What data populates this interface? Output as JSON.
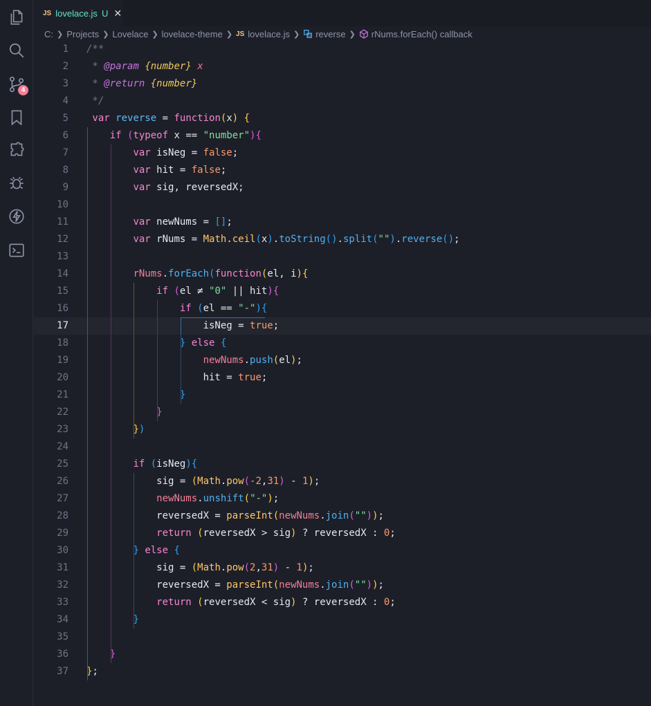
{
  "tab": {
    "js_label": "JS",
    "file_name": "lovelace.js",
    "status": "U",
    "close": "✕"
  },
  "activity_bar": {
    "scm_badge": "4"
  },
  "breadcrumb": {
    "items": [
      "C:",
      "Projects",
      "Lovelace",
      "lovelace-theme"
    ],
    "js_label": "JS",
    "file": "lovelace.js",
    "symbol1": "reverse",
    "symbol2": "rNums.forEach() callback"
  },
  "editor": {
    "current_line": 17,
    "lines": [
      [
        [
          "cm",
          "/**"
        ]
      ],
      [
        [
          "cm",
          " * "
        ],
        [
          "cm-tag",
          "@param"
        ],
        [
          "cm",
          " "
        ],
        [
          "cm-type",
          "{number}"
        ],
        [
          "cm",
          " "
        ],
        [
          "cm-var",
          "x"
        ]
      ],
      [
        [
          "cm",
          " * "
        ],
        [
          "cm-tag",
          "@return"
        ],
        [
          "cm",
          " "
        ],
        [
          "cm-type",
          "{number}"
        ]
      ],
      [
        [
          "cm",
          " */"
        ]
      ],
      [
        [
          "kw",
          " var "
        ],
        [
          "fnname",
          "reverse"
        ],
        [
          "op",
          " = "
        ],
        [
          "kw",
          "function"
        ],
        [
          "p1",
          "("
        ],
        [
          "var",
          "x"
        ],
        [
          "p1",
          ")"
        ],
        [
          "op",
          " "
        ],
        [
          "p1",
          "{"
        ]
      ],
      [
        [
          "op",
          "    "
        ],
        [
          "kw",
          "if"
        ],
        [
          "op",
          " "
        ],
        [
          "p2",
          "("
        ],
        [
          "kw",
          "typeof"
        ],
        [
          "op",
          " x == "
        ],
        [
          "str",
          "\"number\""
        ],
        [
          "p2",
          ")"
        ],
        [
          "p2",
          "{"
        ]
      ],
      [
        [
          "op",
          "        "
        ],
        [
          "kw",
          "var"
        ],
        [
          "op",
          " isNeg = "
        ],
        [
          "bool",
          "false"
        ],
        [
          "op",
          ";"
        ]
      ],
      [
        [
          "op",
          "        "
        ],
        [
          "kw",
          "var"
        ],
        [
          "op",
          " hit = "
        ],
        [
          "bool",
          "false"
        ],
        [
          "op",
          ";"
        ]
      ],
      [
        [
          "op",
          "        "
        ],
        [
          "kw",
          "var"
        ],
        [
          "op",
          " sig, reversedX;"
        ]
      ],
      [],
      [
        [
          "op",
          "        "
        ],
        [
          "kw",
          "var"
        ],
        [
          "op",
          " newNums = "
        ],
        [
          "p3",
          "[]"
        ],
        [
          "op",
          ";"
        ]
      ],
      [
        [
          "op",
          "        "
        ],
        [
          "kw",
          "var"
        ],
        [
          "op",
          " rNums = "
        ],
        [
          "math",
          "Math"
        ],
        [
          "op",
          "."
        ],
        [
          "fn",
          "ceil"
        ],
        [
          "p3",
          "("
        ],
        [
          "var",
          "x"
        ],
        [
          "p3",
          ")"
        ],
        [
          "op",
          "."
        ],
        [
          "meth",
          "toString"
        ],
        [
          "p3",
          "()"
        ],
        [
          "op",
          "."
        ],
        [
          "meth",
          "split"
        ],
        [
          "p3",
          "("
        ],
        [
          "str",
          "\"\""
        ],
        [
          "p3",
          ")"
        ],
        [
          "op",
          "."
        ],
        [
          "meth",
          "reverse"
        ],
        [
          "p3",
          "()"
        ],
        [
          "op",
          ";"
        ]
      ],
      [],
      [
        [
          "op",
          "        "
        ],
        [
          "ident-red",
          "rNums"
        ],
        [
          "op",
          "."
        ],
        [
          "meth",
          "forEach"
        ],
        [
          "p3",
          "("
        ],
        [
          "kw",
          "function"
        ],
        [
          "p1",
          "("
        ],
        [
          "var",
          "el, i"
        ],
        [
          "p1",
          ")"
        ],
        [
          "p1",
          "{"
        ]
      ],
      [
        [
          "op",
          "            "
        ],
        [
          "kw",
          "if"
        ],
        [
          "op",
          " "
        ],
        [
          "p2",
          "("
        ],
        [
          "var",
          "el ≠ "
        ],
        [
          "str",
          "\"0\""
        ],
        [
          "op",
          " || hit"
        ],
        [
          "p2",
          ")"
        ],
        [
          "p2",
          "{"
        ]
      ],
      [
        [
          "op",
          "                "
        ],
        [
          "kw",
          "if"
        ],
        [
          "op",
          " "
        ],
        [
          "p3",
          "("
        ],
        [
          "var",
          "el == "
        ],
        [
          "str",
          "\"-\""
        ],
        [
          "p3",
          ")"
        ],
        [
          "p3",
          "{"
        ]
      ],
      [
        [
          "op",
          "                    isNeg = "
        ],
        [
          "bool",
          "true"
        ],
        [
          "op",
          ";"
        ]
      ],
      [
        [
          "op",
          "                "
        ],
        [
          "p3",
          "}"
        ],
        [
          "op",
          " "
        ],
        [
          "kw",
          "else"
        ],
        [
          "op",
          " "
        ],
        [
          "p3",
          "{"
        ]
      ],
      [
        [
          "op",
          "                    "
        ],
        [
          "ident-red",
          "newNums"
        ],
        [
          "op",
          "."
        ],
        [
          "meth",
          "push"
        ],
        [
          "p1",
          "("
        ],
        [
          "var",
          "el"
        ],
        [
          "p1",
          ")"
        ],
        [
          "op",
          ";"
        ]
      ],
      [
        [
          "op",
          "                    hit = "
        ],
        [
          "bool",
          "true"
        ],
        [
          "op",
          ";"
        ]
      ],
      [
        [
          "op",
          "                "
        ],
        [
          "p3",
          "}"
        ]
      ],
      [
        [
          "op",
          "            "
        ],
        [
          "p2",
          "}"
        ]
      ],
      [
        [
          "op",
          "        "
        ],
        [
          "p1",
          "}"
        ],
        [
          "p3",
          ")"
        ]
      ],
      [],
      [
        [
          "op",
          "        "
        ],
        [
          "kw",
          "if"
        ],
        [
          "op",
          " "
        ],
        [
          "p3",
          "("
        ],
        [
          "var",
          "isNeg"
        ],
        [
          "p3",
          ")"
        ],
        [
          "p3",
          "{"
        ]
      ],
      [
        [
          "op",
          "            sig = "
        ],
        [
          "p1",
          "("
        ],
        [
          "math",
          "Math"
        ],
        [
          "op",
          "."
        ],
        [
          "fn",
          "pow"
        ],
        [
          "p2",
          "("
        ],
        [
          "num",
          "-2"
        ],
        [
          "op",
          ","
        ],
        [
          "num",
          "31"
        ],
        [
          "p2",
          ")"
        ],
        [
          "op",
          " - "
        ],
        [
          "num",
          "1"
        ],
        [
          "p1",
          ")"
        ],
        [
          "op",
          ";"
        ]
      ],
      [
        [
          "op",
          "            "
        ],
        [
          "ident-red",
          "newNums"
        ],
        [
          "op",
          "."
        ],
        [
          "meth",
          "unshift"
        ],
        [
          "p1",
          "("
        ],
        [
          "str",
          "\"-\""
        ],
        [
          "p1",
          ")"
        ],
        [
          "op",
          ";"
        ]
      ],
      [
        [
          "op",
          "            reversedX = "
        ],
        [
          "fn",
          "parseInt"
        ],
        [
          "p1",
          "("
        ],
        [
          "ident-red",
          "newNums"
        ],
        [
          "op",
          "."
        ],
        [
          "meth",
          "join"
        ],
        [
          "p2",
          "("
        ],
        [
          "str",
          "\"\""
        ],
        [
          "p2",
          ")"
        ],
        [
          "p1",
          ")"
        ],
        [
          "op",
          ";"
        ]
      ],
      [
        [
          "op",
          "            "
        ],
        [
          "kw",
          "return"
        ],
        [
          "op",
          " "
        ],
        [
          "p1",
          "("
        ],
        [
          "var",
          "reversedX > sig"
        ],
        [
          "p1",
          ")"
        ],
        [
          "op",
          " ? reversedX : "
        ],
        [
          "num",
          "0"
        ],
        [
          "op",
          ";"
        ]
      ],
      [
        [
          "op",
          "        "
        ],
        [
          "p3",
          "}"
        ],
        [
          "op",
          " "
        ],
        [
          "kw",
          "else"
        ],
        [
          "op",
          " "
        ],
        [
          "p3",
          "{"
        ]
      ],
      [
        [
          "op",
          "            sig = "
        ],
        [
          "p1",
          "("
        ],
        [
          "math",
          "Math"
        ],
        [
          "op",
          "."
        ],
        [
          "fn",
          "pow"
        ],
        [
          "p2",
          "("
        ],
        [
          "num",
          "2"
        ],
        [
          "op",
          ","
        ],
        [
          "num",
          "31"
        ],
        [
          "p2",
          ")"
        ],
        [
          "op",
          " - "
        ],
        [
          "num",
          "1"
        ],
        [
          "p1",
          ")"
        ],
        [
          "op",
          ";"
        ]
      ],
      [
        [
          "op",
          "            reversedX = "
        ],
        [
          "fn",
          "parseInt"
        ],
        [
          "p1",
          "("
        ],
        [
          "ident-red",
          "newNums"
        ],
        [
          "op",
          "."
        ],
        [
          "meth",
          "join"
        ],
        [
          "p2",
          "("
        ],
        [
          "str",
          "\"\""
        ],
        [
          "p2",
          ")"
        ],
        [
          "p1",
          ")"
        ],
        [
          "op",
          ";"
        ]
      ],
      [
        [
          "op",
          "            "
        ],
        [
          "kw",
          "return"
        ],
        [
          "op",
          " "
        ],
        [
          "p1",
          "("
        ],
        [
          "var",
          "reversedX < sig"
        ],
        [
          "p1",
          ")"
        ],
        [
          "op",
          " ? reversedX : "
        ],
        [
          "num",
          "0"
        ],
        [
          "op",
          ";"
        ]
      ],
      [
        [
          "op",
          "        "
        ],
        [
          "p3",
          "}"
        ]
      ],
      [],
      [
        [
          "op",
          "    "
        ],
        [
          "p2",
          "}"
        ]
      ],
      [
        [
          "p1",
          "}"
        ],
        [
          "op",
          ";"
        ]
      ]
    ]
  },
  "colors": {
    "background": "#1d1f28",
    "keyword": "#f686d2",
    "string": "#7ee29d",
    "number": "#f89b6c",
    "accent": "#5de4c7"
  }
}
